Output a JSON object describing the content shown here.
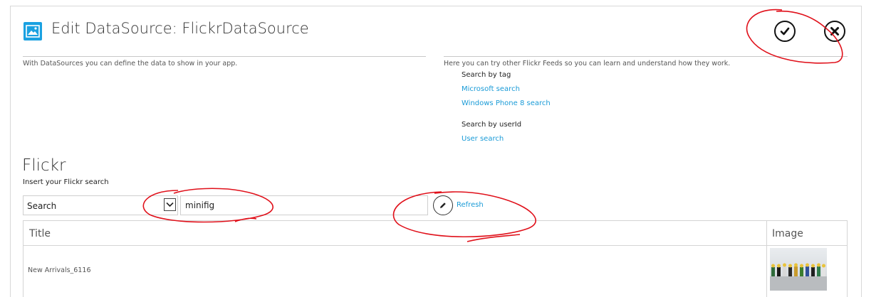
{
  "header": {
    "title": "Edit DataSource: FlickrDataSource",
    "icon": "image-icon",
    "accent_color": "#1aa1e1"
  },
  "actions": {
    "ok_icon": "checkmark-icon",
    "cancel_icon": "close-icon"
  },
  "left_panel": {
    "description": "With DataSources you can define the data to show in your app."
  },
  "right_panel": {
    "description": "Here you can try other Flickr Feeds so you can learn and understand how they work.",
    "tag_label": "Search by tag",
    "tag_links": [
      "Microsoft search",
      "Windows Phone 8 search"
    ],
    "user_label": "Search by userId",
    "user_links": [
      "User search"
    ],
    "link_color": "#1a9bd7"
  },
  "flickr": {
    "title": "Flickr",
    "subtitle": "Insert your Flickr search",
    "search_type": "Search",
    "search_value": "minifig",
    "refresh_label": "Refresh"
  },
  "table": {
    "columns": [
      "Title",
      "Image"
    ],
    "rows": [
      {
        "title": "New Arrivals_6116",
        "image": "lego-minifigures-thumbnail"
      }
    ]
  },
  "annotation_color": "#e0101a"
}
